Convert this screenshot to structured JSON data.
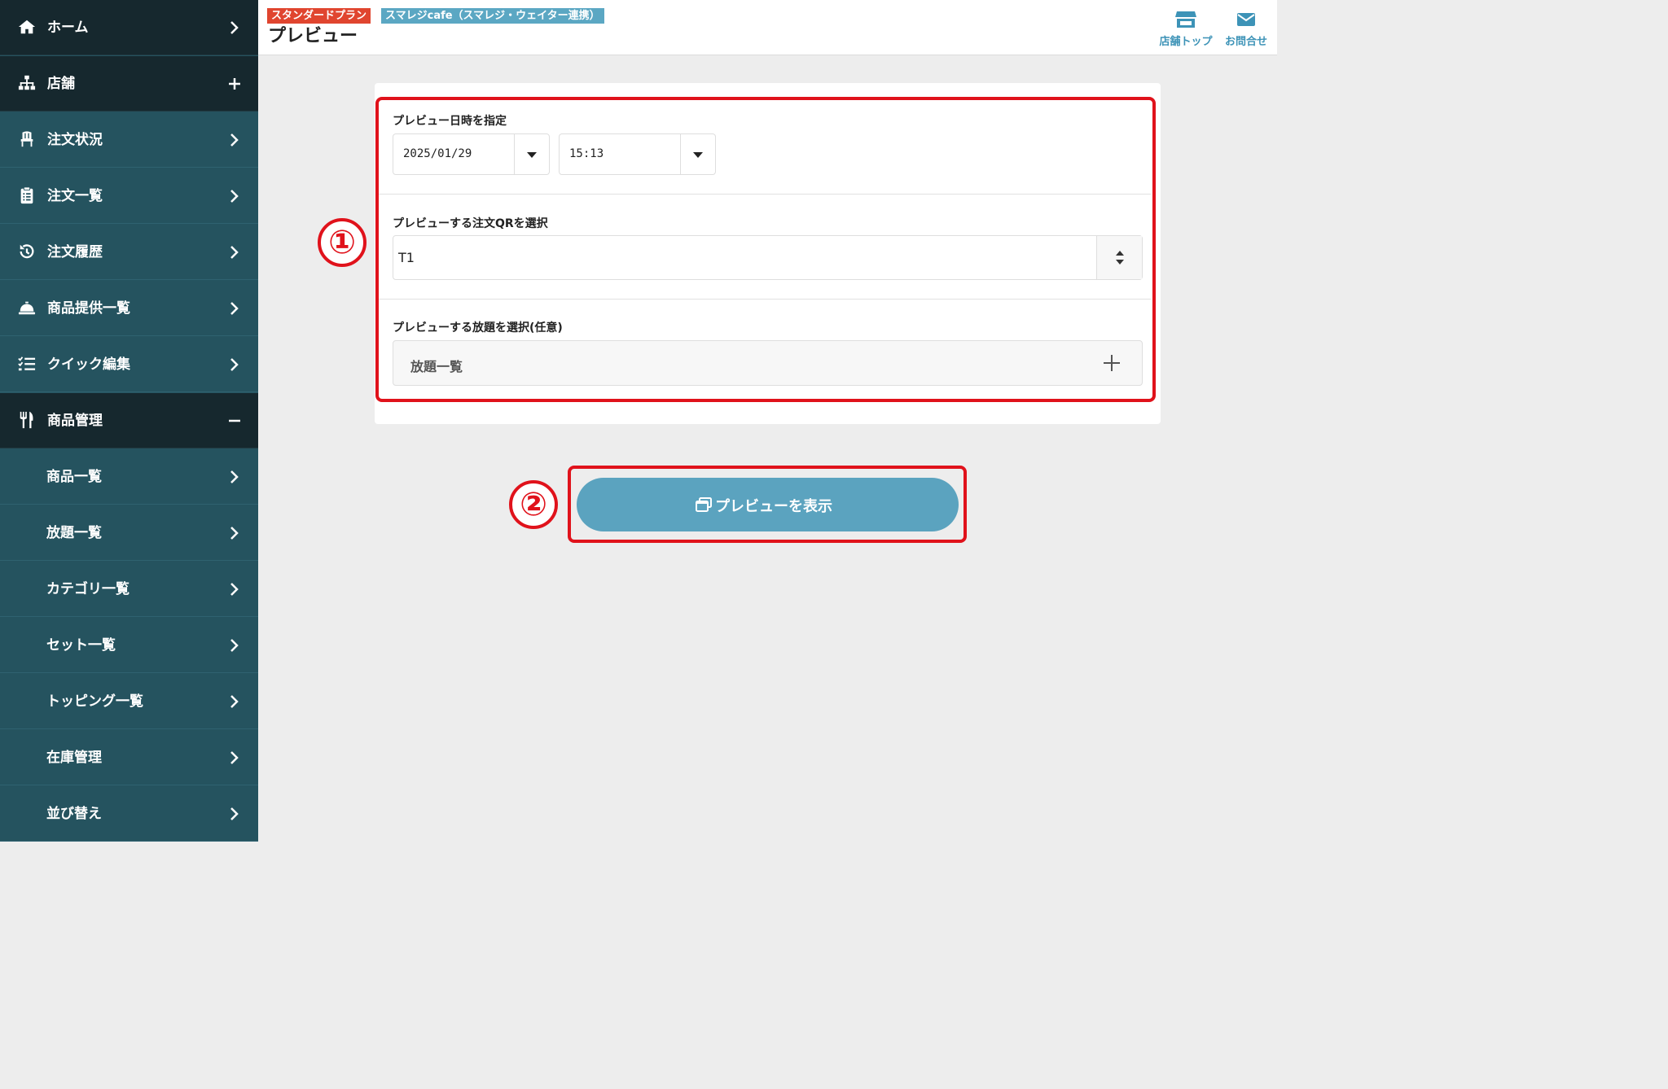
{
  "sidebar": {
    "items": [
      {
        "label": "ホーム",
        "icon": "home-icon",
        "control": "chevron-right"
      },
      {
        "label": "店舗",
        "icon": "sitemap-icon",
        "control": "plus"
      },
      {
        "label": "注文状況",
        "icon": "chair-icon",
        "control": "chevron-right"
      },
      {
        "label": "注文一覧",
        "icon": "clipboard-icon",
        "control": "chevron-right"
      },
      {
        "label": "注文履歴",
        "icon": "history-icon",
        "control": "chevron-right"
      },
      {
        "label": "商品提供一覧",
        "icon": "bell-icon",
        "control": "chevron-right"
      },
      {
        "label": "クイック編集",
        "icon": "checklist-icon",
        "control": "chevron-right"
      },
      {
        "label": "商品管理",
        "icon": "utensils-icon",
        "control": "minus"
      }
    ],
    "subitems": [
      {
        "label": "商品一覧"
      },
      {
        "label": "放題一覧"
      },
      {
        "label": "カテゴリ一覧"
      },
      {
        "label": "セット一覧"
      },
      {
        "label": "トッピング一覧"
      },
      {
        "label": "在庫管理"
      },
      {
        "label": "並び替え"
      }
    ]
  },
  "header": {
    "plan_badge": "スタンダードプラン",
    "store_badge": "スマレジcafe（スマレジ・ウェイター連携）",
    "title": "プレビュー",
    "store_top_label": "店舗トップ",
    "contact_label": "お問合せ"
  },
  "form": {
    "datetime_label": "プレビュー日時を指定",
    "date_value": "2025/01/29",
    "time_value": "15:13",
    "qr_label": "プレビューする注文QRを選択",
    "qr_value": "T1",
    "plans_label": "プレビューする放題を選択(任意)",
    "plans_button": "放題一覧"
  },
  "annotations": {
    "marker_1": "①",
    "marker_2": "②"
  },
  "preview_button": {
    "label": "プレビューを表示"
  },
  "colors": {
    "sidebar": "#25535f",
    "sidebar_dark": "#16282e",
    "accent": "#5ba3bf",
    "plan_badge": "#e0452f",
    "annotation": "#e0121b"
  }
}
